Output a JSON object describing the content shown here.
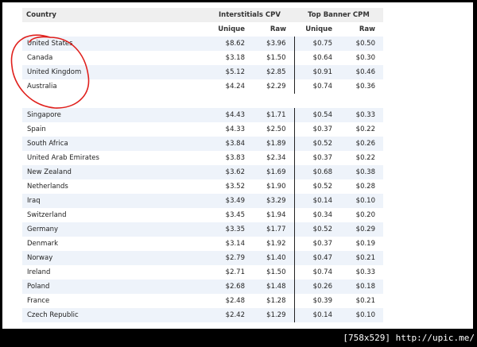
{
  "header": {
    "country_label": "Country",
    "group1_label": "Interstitials CPV",
    "group2_label": "Top Banner CPM",
    "sub_unique": "Unique",
    "sub_raw": "Raw"
  },
  "rows_top": [
    {
      "country": "United States",
      "i_unique": "$8.62",
      "i_raw": "$3.96",
      "b_unique": "$0.75",
      "b_raw": "$0.50"
    },
    {
      "country": "Canada",
      "i_unique": "$3.18",
      "i_raw": "$1.50",
      "b_unique": "$0.64",
      "b_raw": "$0.30"
    },
    {
      "country": "United Kingdom",
      "i_unique": "$5.12",
      "i_raw": "$2.85",
      "b_unique": "$0.91",
      "b_raw": "$0.46"
    },
    {
      "country": "Australia",
      "i_unique": "$4.24",
      "i_raw": "$2.29",
      "b_unique": "$0.74",
      "b_raw": "$0.36"
    }
  ],
  "rows_bottom": [
    {
      "country": "Singapore",
      "i_unique": "$4.43",
      "i_raw": "$1.71",
      "b_unique": "$0.54",
      "b_raw": "$0.33"
    },
    {
      "country": "Spain",
      "i_unique": "$4.33",
      "i_raw": "$2.50",
      "b_unique": "$0.37",
      "b_raw": "$0.22"
    },
    {
      "country": "South Africa",
      "i_unique": "$3.84",
      "i_raw": "$1.89",
      "b_unique": "$0.52",
      "b_raw": "$0.26"
    },
    {
      "country": "United Arab Emirates",
      "i_unique": "$3.83",
      "i_raw": "$2.34",
      "b_unique": "$0.37",
      "b_raw": "$0.22"
    },
    {
      "country": "New Zealand",
      "i_unique": "$3.62",
      "i_raw": "$1.69",
      "b_unique": "$0.68",
      "b_raw": "$0.38"
    },
    {
      "country": "Netherlands",
      "i_unique": "$3.52",
      "i_raw": "$1.90",
      "b_unique": "$0.52",
      "b_raw": "$0.28"
    },
    {
      "country": "Iraq",
      "i_unique": "$3.49",
      "i_raw": "$3.29",
      "b_unique": "$0.14",
      "b_raw": "$0.10"
    },
    {
      "country": "Switzerland",
      "i_unique": "$3.45",
      "i_raw": "$1.94",
      "b_unique": "$0.34",
      "b_raw": "$0.20"
    },
    {
      "country": "Germany",
      "i_unique": "$3.35",
      "i_raw": "$1.77",
      "b_unique": "$0.52",
      "b_raw": "$0.29"
    },
    {
      "country": "Denmark",
      "i_unique": "$3.14",
      "i_raw": "$1.92",
      "b_unique": "$0.37",
      "b_raw": "$0.19"
    },
    {
      "country": "Norway",
      "i_unique": "$2.79",
      "i_raw": "$1.40",
      "b_unique": "$0.47",
      "b_raw": "$0.21"
    },
    {
      "country": "Ireland",
      "i_unique": "$2.71",
      "i_raw": "$1.50",
      "b_unique": "$0.74",
      "b_raw": "$0.33"
    },
    {
      "country": "Poland",
      "i_unique": "$2.68",
      "i_raw": "$1.48",
      "b_unique": "$0.26",
      "b_raw": "$0.18"
    },
    {
      "country": "France",
      "i_unique": "$2.48",
      "i_raw": "$1.28",
      "b_unique": "$0.39",
      "b_raw": "$0.21"
    },
    {
      "country": "Czech Republic",
      "i_unique": "$2.42",
      "i_raw": "$1.29",
      "b_unique": "$0.14",
      "b_raw": "$0.10"
    }
  ],
  "caption": "[758x529] http://upic.me/",
  "colors": {
    "circle": "#e0201c",
    "stripe": "#eef3fa",
    "header_bg": "#efefef"
  }
}
